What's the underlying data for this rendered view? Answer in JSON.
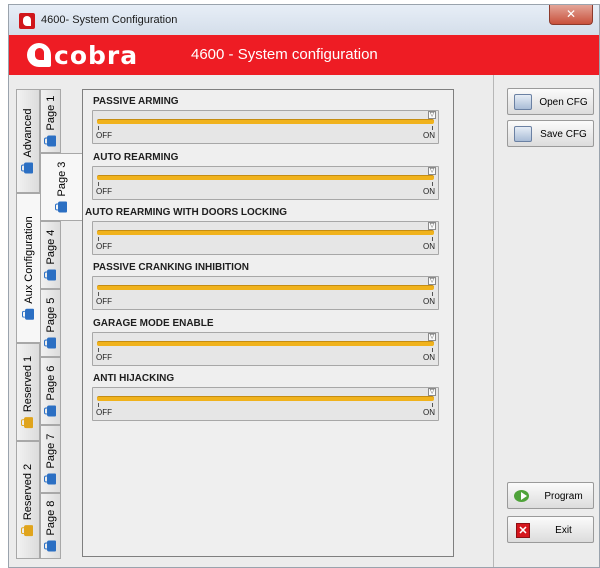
{
  "window": {
    "title": "4600-  System Configuration",
    "close_glyph": "✕"
  },
  "banner": {
    "logo_text": "cobra",
    "title": "4600 - System configuration",
    "color": "#ee1c24"
  },
  "outer_tabs": [
    {
      "label": "Advanced",
      "icon": "folder-icon",
      "active": false
    },
    {
      "label": "Aux Configuration",
      "icon": "folder-icon",
      "active": true
    },
    {
      "label": "Reserved 1",
      "icon": "lock-icon",
      "active": false
    },
    {
      "label": "Reserved 2",
      "icon": "lock-icon",
      "active": false
    }
  ],
  "inner_tabs": [
    {
      "label": "Page 1",
      "active": false
    },
    {
      "label": "Page 3",
      "active": true
    },
    {
      "label": "Page 4",
      "active": false
    },
    {
      "label": "Page 5",
      "active": false
    },
    {
      "label": "Page 6",
      "active": false
    },
    {
      "label": "Page 7",
      "active": false
    },
    {
      "label": "Page 8",
      "active": false
    }
  ],
  "settings": [
    {
      "label": "PASSIVE ARMING",
      "off": "OFF",
      "on": "ON",
      "value": 1
    },
    {
      "label": "AUTO REARMING",
      "off": "OFF",
      "on": "ON",
      "value": 1
    },
    {
      "label": "AUTO REARMING WITH DOORS LOCKING",
      "off": "OFF",
      "on": "ON",
      "value": 1
    },
    {
      "label": "PASSIVE CRANKING INHIBITION",
      "off": "OFF",
      "on": "ON",
      "value": 1
    },
    {
      "label": "GARAGE MODE ENABLE",
      "off": "OFF",
      "on": "ON",
      "value": 1
    },
    {
      "label": "ANTI HIJACKING",
      "off": "OFF",
      "on": "ON",
      "value": 1
    }
  ],
  "buttons": {
    "open_cfg": {
      "label": "Open CFG",
      "icon": "open-folder-icon"
    },
    "save_cfg": {
      "label": "Save CFG",
      "icon": "save-icon"
    },
    "program": {
      "label": "Program",
      "icon": "program-arrow-icon"
    },
    "exit": {
      "label": "Exit",
      "icon": "exit-icon",
      "glyph": "✕"
    }
  },
  "colors": {
    "slider_fill": "#f0b21c",
    "tab_icon": "#2b6fc3",
    "lock_icon": "#e0a41c"
  }
}
